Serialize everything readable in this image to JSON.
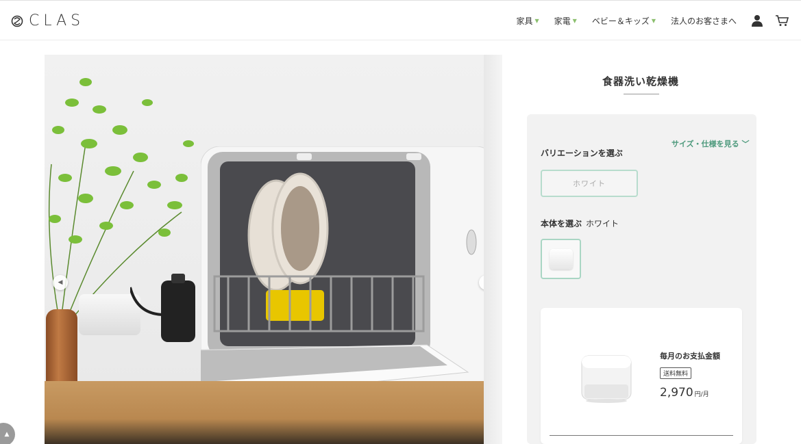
{
  "brand": {
    "logo_text": "CLAS"
  },
  "nav": {
    "items": [
      {
        "label": "家具",
        "has_caret": true
      },
      {
        "label": "家電",
        "has_caret": true
      },
      {
        "label": "ベビー＆キッズ",
        "has_caret": true
      },
      {
        "label": "法人のお客さまへ",
        "has_caret": false
      }
    ],
    "icons": [
      "user-icon",
      "cart-icon"
    ]
  },
  "product": {
    "title": "食器洗い乾燥機",
    "spec_link": "サイズ・仕様を見る",
    "variation_label": "バリエーションを選ぶ",
    "variation_option": "ホワイト",
    "body_label": "本体を選ぶ",
    "body_value": "ホワイト",
    "payment_label": "毎月のお支払金額",
    "shipping_badge": "送料無料",
    "price": "2,970",
    "price_unit": "円/月"
  },
  "colors": {
    "accent": "#4e9a7d",
    "caret": "#8bbf6e",
    "panel_bg": "#f2f2f2"
  }
}
